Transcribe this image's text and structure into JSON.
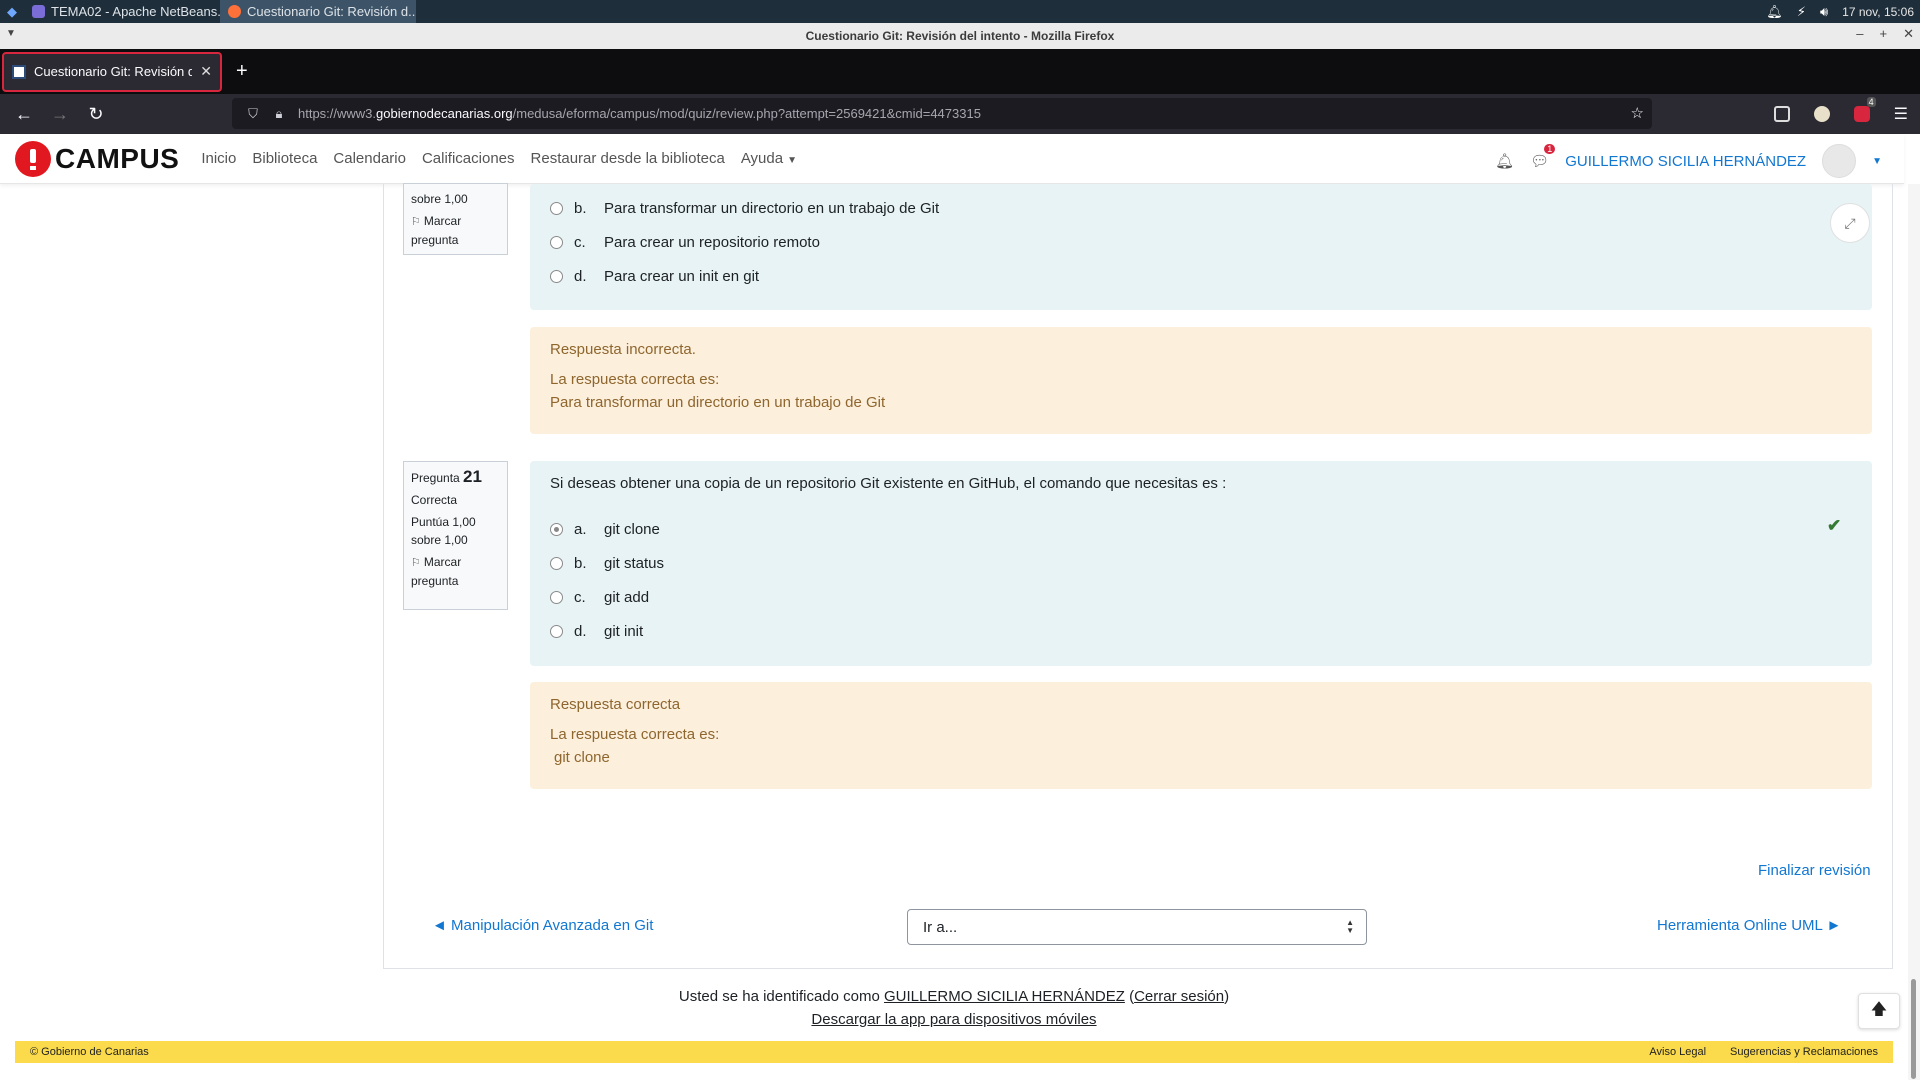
{
  "taskbar": {
    "tasks": [
      {
        "label": "TEMA02 - Apache NetBeans..."
      },
      {
        "label": "Cuestionario Git: Revisión d..."
      }
    ],
    "datetime": "17 nov, 15:06"
  },
  "window": {
    "title": "Cuestionario Git: Revisión del intento - Mozilla Firefox"
  },
  "browser": {
    "tab_label": "Cuestionario Git: Revisión del intento",
    "url_prefix": "https://www3.",
    "url_host": "gobiernodecanarias.org",
    "url_path": "/medusa/eforma/campus/mod/quiz/review.php?attempt=2569421&cmid=4473315",
    "extension_badge": "4"
  },
  "header": {
    "logo_text": "CAMPUS",
    "nav": [
      "Inicio",
      "Biblioteca",
      "Calendario",
      "Calificaciones",
      "Restaurar desde la biblioteca",
      "Ayuda"
    ],
    "messages_badge": "1",
    "user_name": "GUILLERMO SICILIA HERNÁNDEZ"
  },
  "question20": {
    "info_score_tail": "sobre 1,00",
    "flag_label_1": "Marcar",
    "flag_label_2": "pregunta",
    "options": [
      {
        "letter": "b.",
        "text": "Para transformar un directorio en un trabajo de Git"
      },
      {
        "letter": "c.",
        "text": "Para crear un repositorio remoto"
      },
      {
        "letter": "d.",
        "text": "Para crear un init en git"
      }
    ],
    "feedback_status": "Respuesta incorrecta.",
    "feedback_label": "La respuesta correcta es:",
    "feedback_answer": "Para transformar un directorio en un trabajo de Git"
  },
  "question21": {
    "label": "Pregunta",
    "number": "21",
    "state": "Correcta",
    "score_line1": "Puntúa 1,00",
    "score_line2": "sobre 1,00",
    "flag_label_1": "Marcar",
    "flag_label_2": "pregunta",
    "prompt": "Si deseas obtener una copia de un repositorio Git existente en GitHub, el comando que necesitas es :",
    "options": [
      {
        "letter": "a.",
        "text": "git clone",
        "selected": true
      },
      {
        "letter": "b.",
        "text": "git status",
        "selected": false
      },
      {
        "letter": "c.",
        "text": "git add",
        "selected": false
      },
      {
        "letter": "d.",
        "text": "git init",
        "selected": false
      }
    ],
    "feedback_status": "Respuesta correcta",
    "feedback_label": "La respuesta correcta es:",
    "feedback_answer": "git clone"
  },
  "navigation": {
    "finish_review": "Finalizar revisión",
    "prev_activity": "◄ Manipulación Avanzada en Git",
    "jump_placeholder": "Ir a...",
    "next_activity": "Herramienta Online UML ►"
  },
  "footer": {
    "logged_prefix": "Usted se ha identificado como",
    "logged_user": "GUILLERMO SICILIA HERNÁNDEZ",
    "logout": "Cerrar sesión",
    "app_link": "Descargar la app para dispositivos móviles",
    "copyright": "© Gobierno de Canarias",
    "legal": "Aviso Legal",
    "suggestions": "Sugerencias y Reclamaciones"
  },
  "colors": {
    "accent_blue": "#1177d1",
    "question_bg": "#e7f3f5",
    "feedback_bg": "#fcefdc",
    "footer_bar": "#fbdb4c",
    "logo_red": "#e1181f",
    "correct_green": "#357a32"
  },
  "icons": [
    "start-menu-icon",
    "bell-icon",
    "lightning-icon",
    "volume-icon",
    "back-icon",
    "forward-icon",
    "reload-icon",
    "shield-icon",
    "lock-icon",
    "star-icon",
    "pocket-icon",
    "menu-icon",
    "notifications-icon",
    "messages-icon",
    "flag-icon",
    "check-icon",
    "expand-icon",
    "arrow-up-icon"
  ]
}
